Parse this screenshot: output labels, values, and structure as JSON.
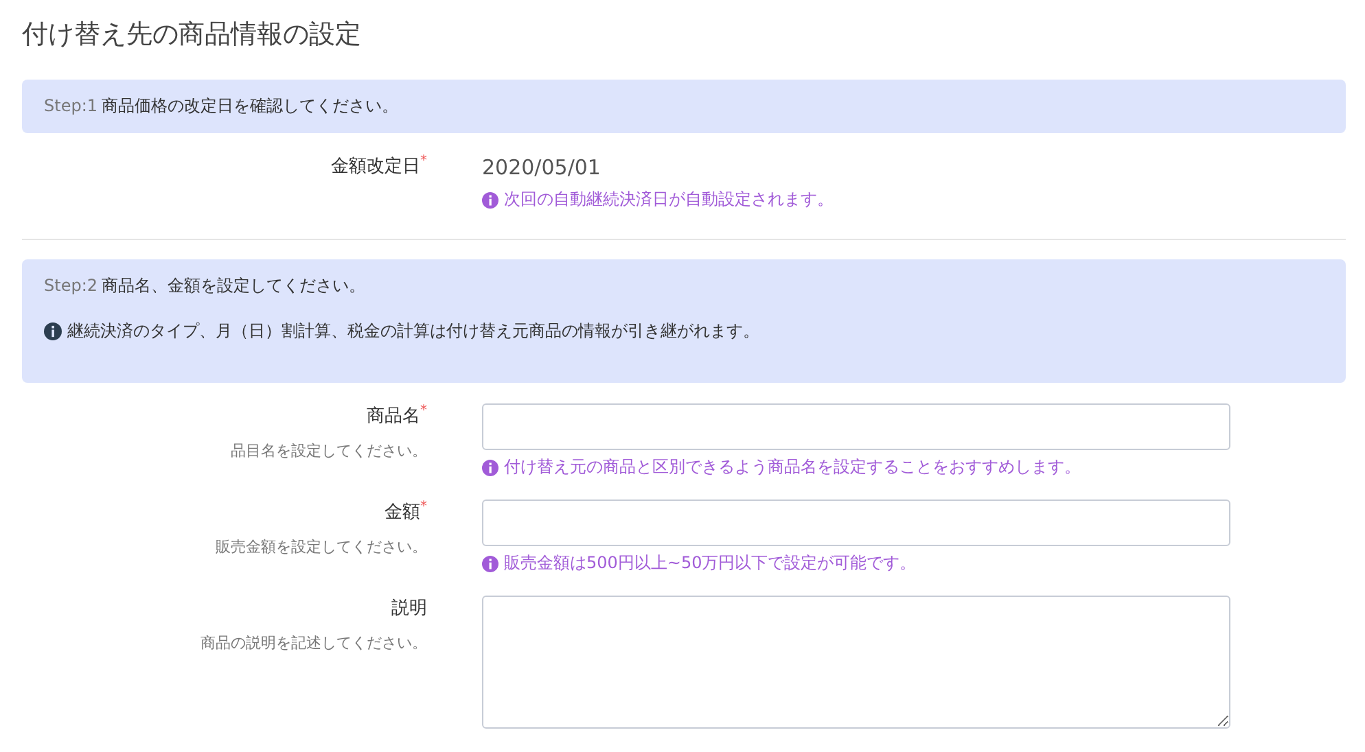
{
  "title": "付け替え先の商品情報の設定",
  "steps": [
    {
      "step": "Step:1",
      "message": "商品価格の改定日を確認してください。",
      "fields": [
        {
          "kind": "display",
          "label": "金額改定日",
          "required_mark": "*",
          "value": "2020/05/01",
          "hint": "次回の自動継続決済日が自動設定されます。"
        }
      ]
    },
    {
      "step": "Step:2",
      "message": "商品名、金額を設定してください。",
      "note": "継続決済のタイプ、月（日）割計算、税金の計算は付け替え元商品の情報が引き継がれます。",
      "fields": [
        {
          "kind": "text",
          "label": "商品名",
          "required_mark": "*",
          "description": "品目名を設定してください。",
          "hint": "付け替え元の商品と区別できるよう商品名を設定することをおすすめします。"
        },
        {
          "kind": "text",
          "label": "金額",
          "required_mark": "*",
          "description": "販売金額を設定してください。",
          "hint": "販売金額は500円以上~50万円以下で設定が可能です。"
        },
        {
          "kind": "textarea",
          "label": "説明",
          "description": "商品の説明を記述してください。"
        }
      ]
    }
  ]
}
